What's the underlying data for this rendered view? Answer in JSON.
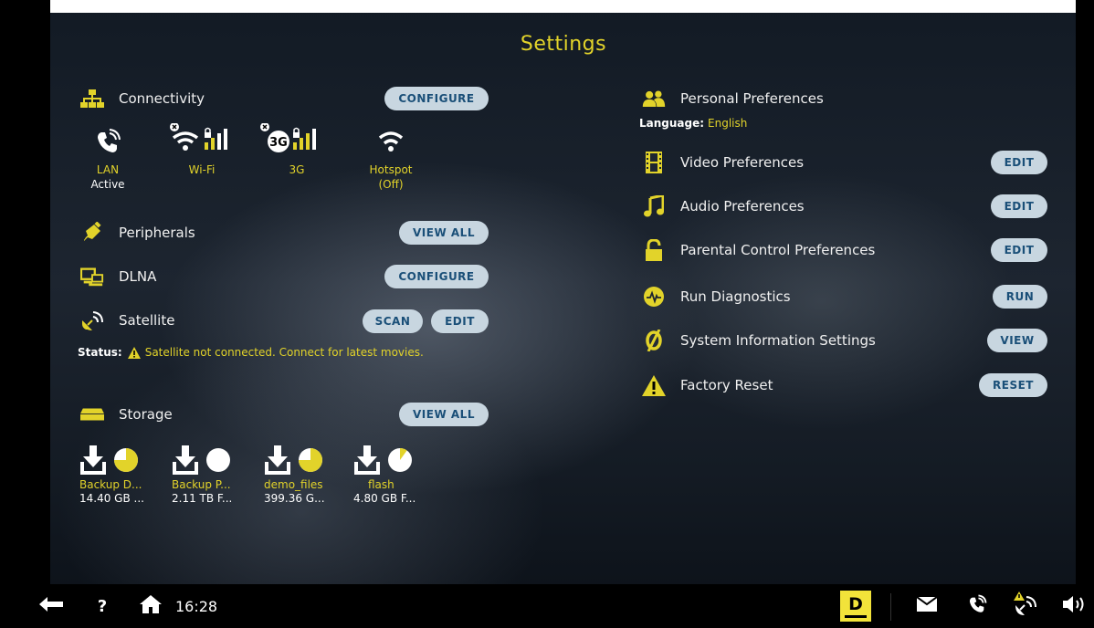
{
  "title": "Settings",
  "connectivity": {
    "label": "Connectivity",
    "configure_label": "CONFIGURE",
    "items": [
      {
        "label": "LAN",
        "sub": "Active",
        "icon": "phone-icon"
      },
      {
        "label": "Wi-Fi",
        "sub": "",
        "icon": "wifi-icon"
      },
      {
        "label": "3G",
        "sub": "",
        "icon": "3g-icon"
      },
      {
        "label": "Hotspot",
        "sub": "(Off)",
        "icon": "hotspot-icon"
      }
    ],
    "three_g_badge": "3G"
  },
  "peripherals": {
    "label": "Peripherals",
    "view_all_label": "VIEW ALL"
  },
  "dlna": {
    "label": "DLNA",
    "configure_label": "CONFIGURE"
  },
  "satellite": {
    "label": "Satellite",
    "scan_label": "SCAN",
    "edit_label": "EDIT",
    "status_label": "Status:",
    "status_text": "Satellite not connected. Connect for latest movies."
  },
  "storage": {
    "label": "Storage",
    "view_all_label": "VIEW ALL",
    "items": [
      {
        "name": "Backup D...",
        "size": "14.40 GB ...",
        "used_fraction": 0.75
      },
      {
        "name": "Backup P...",
        "size": "2.11 TB F...",
        "used_fraction": 0.0
      },
      {
        "name": "demo_files",
        "size": "399.36 G...",
        "used_fraction": 0.75
      },
      {
        "name": "flash",
        "size": "4.80 GB F...",
        "used_fraction": 0.1
      }
    ]
  },
  "personal": {
    "label": "Personal Preferences",
    "language_label": "Language:",
    "language_value": "English"
  },
  "video": {
    "label": "Video Preferences",
    "action": "EDIT"
  },
  "audio": {
    "label": "Audio Preferences",
    "action": "EDIT"
  },
  "parental": {
    "label": "Parental Control Preferences",
    "action": "EDIT"
  },
  "diagnostics": {
    "label": "Run Diagnostics",
    "action": "RUN"
  },
  "sysinfo": {
    "label": "System Information Settings",
    "action": "VIEW"
  },
  "factory": {
    "label": "Factory Reset",
    "action": "RESET"
  },
  "bottom_bar": {
    "clock": "16:28",
    "help": "?",
    "logo_text": "D"
  },
  "colors": {
    "accent": "#e2d32a",
    "pill_bg": "#c8d6e0",
    "pill_text": "#1a4f78"
  }
}
